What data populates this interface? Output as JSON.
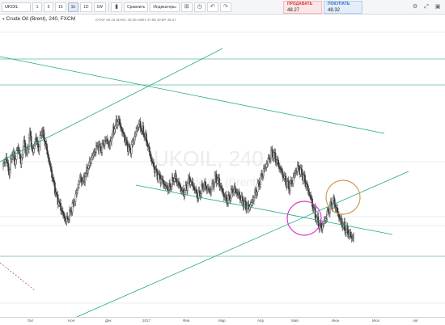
{
  "toolbar": {
    "symbol": "UKOIL",
    "intervals": [
      "1",
      "5",
      "15",
      "1h",
      "1D",
      "1W"
    ],
    "active_interval": "1h",
    "compare_label": "Сравнить",
    "indicators_label": "Индикаторы",
    "sell": {
      "label": "ПРОДАВАТЬ",
      "price": "48.27"
    },
    "buy": {
      "label": "ПОКУПАТЬ",
      "price": "48.32"
    }
  },
  "legend": {
    "title": "Crude Oil (Brent), 240, FXCM",
    "ohlc": "ОТКР 48.15 МАКС 48.35 МИН 47.95 ЗАКР 48.27"
  },
  "watermark": {
    "symbol": "UKOIL, 240",
    "name": "Crude Oil (Brent)"
  },
  "time_axis": {
    "labels": [
      "Окт",
      "Ноя",
      "Дек",
      "2017",
      "Фев",
      "Мар",
      "Апр",
      "Май",
      "Июн",
      "Июл",
      "Авг"
    ]
  },
  "colors": {
    "channel_line": "#20a787",
    "horizontal_line": "#79c69b",
    "candle": "#3a3a3a",
    "highlight_circle_1": "#d63cc8",
    "highlight_circle_2": "#d29a5a",
    "dashed_line": "#b04545"
  },
  "chart_data": {
    "type": "candlestick",
    "instrument": "Crude Oil (Brent)",
    "timeframe": "240",
    "x_labels": [
      "Окт",
      "Ноя",
      "Дек",
      "2017",
      "Фев",
      "Мар",
      "Апр",
      "Май",
      "Июн",
      "Июл",
      "Авг"
    ],
    "price_path": [
      0.56,
      0.6,
      0.52,
      0.63,
      0.58,
      0.66,
      0.57,
      0.68,
      0.61,
      0.72,
      0.62,
      0.7,
      0.64,
      0.74,
      0.69,
      0.62,
      0.55,
      0.48,
      0.41,
      0.37,
      0.33,
      0.29,
      0.3,
      0.34,
      0.38,
      0.44,
      0.5,
      0.48,
      0.52,
      0.56,
      0.6,
      0.63,
      0.66,
      0.64,
      0.67,
      0.69,
      0.66,
      0.72,
      0.76,
      0.79,
      0.74,
      0.7,
      0.66,
      0.63,
      0.68,
      0.73,
      0.77,
      0.74,
      0.71,
      0.66,
      0.6,
      0.55,
      0.52,
      0.5,
      0.48,
      0.46,
      0.45,
      0.47,
      0.51,
      0.48,
      0.45,
      0.42,
      0.45,
      0.49,
      0.47,
      0.44,
      0.41,
      0.44,
      0.47,
      0.45,
      0.43,
      0.46,
      0.5,
      0.48,
      0.44,
      0.41,
      0.39,
      0.42,
      0.45,
      0.43,
      0.41,
      0.38,
      0.36,
      0.35,
      0.37,
      0.41,
      0.45,
      0.49,
      0.53,
      0.56,
      0.59,
      0.62,
      0.6,
      0.57,
      0.54,
      0.51,
      0.48,
      0.46,
      0.49,
      0.53,
      0.55,
      0.52,
      0.49,
      0.45,
      0.41,
      0.36,
      0.31,
      0.27,
      0.26,
      0.29,
      0.33,
      0.36,
      0.38,
      0.34,
      0.3,
      0.27,
      0.25,
      0.23,
      0.21,
      0.2
    ]
  }
}
